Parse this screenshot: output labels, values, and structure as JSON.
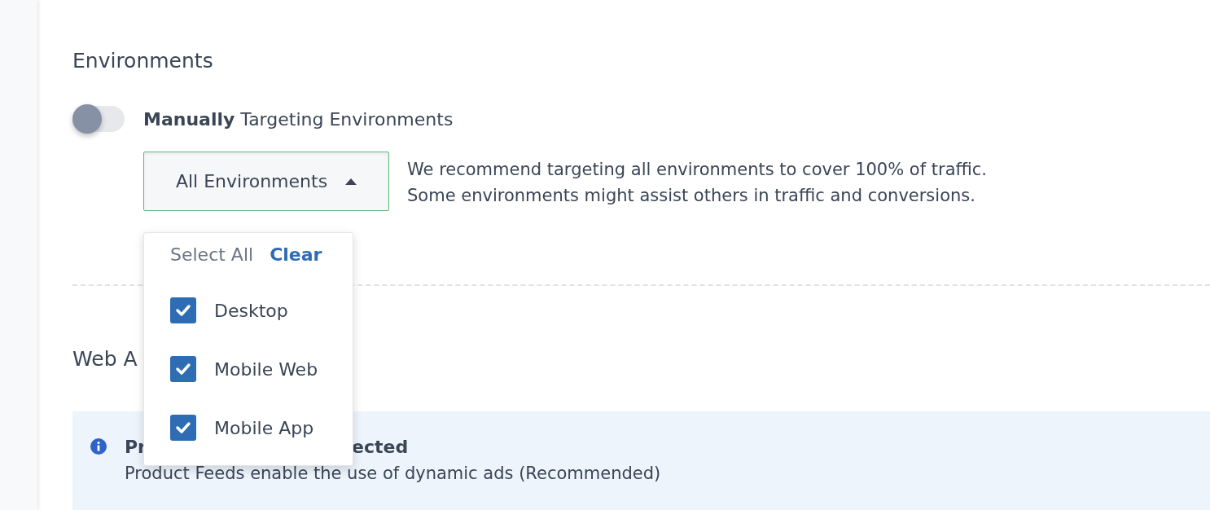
{
  "section": {
    "title": "Environments"
  },
  "targeting": {
    "on": false,
    "label": "**Manually** Targeting Environments"
  },
  "dropdown": {
    "value": "All Environments",
    "expanded": true,
    "help": [
      "We recommend targeting all environments to cover 100% of traffic.",
      "Some environments might assist others in traffic and conversions."
    ]
  },
  "menu": {
    "select_all": "Select All",
    "clear": "Clear",
    "options": [
      {
        "label": "Desktop",
        "checked": true
      },
      {
        "label": "Mobile Web",
        "checked": true
      },
      {
        "label": "Mobile App",
        "checked": true
      }
    ]
  },
  "web_section": {
    "title": "Web A"
  },
  "notice": {
    "title_parts": [
      "Pr",
      "ected"
    ],
    "body": "Product Feeds enable the use of dynamic ads (Recommended)"
  }
}
